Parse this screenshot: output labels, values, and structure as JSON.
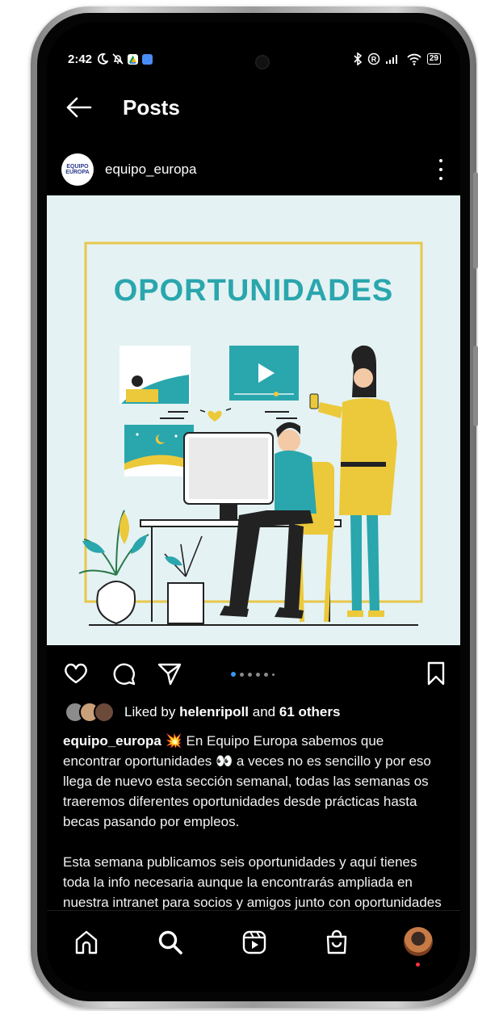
{
  "status_bar": {
    "time": "2:42",
    "battery": "29"
  },
  "app_bar": {
    "title": "Posts"
  },
  "post": {
    "username": "equipo_europa",
    "avatar_text": "EQUIPO EUROPA",
    "image": {
      "heading": "OPORTUNIDADES",
      "background_color": "#e4f2f3",
      "frame_color": "#e8c74a",
      "accent_teal": "#2aa6ad",
      "accent_yellow": "#ecc93a"
    },
    "carousel": {
      "total": 6,
      "active": 1
    },
    "likes": {
      "prefix": "Liked by",
      "user": "helenripoll",
      "middle": "and",
      "others": "61 others"
    },
    "caption": {
      "username": "equipo_europa",
      "paragraph1": "💥 En Equipo Europa sabemos que encontrar oportunidades 👀 a veces no es sencillo y por eso llega de nuevo esta sección semanal, todas las semanas os traeremos diferentes oportunidades desde prácticas hasta becas pasando por empleos.",
      "paragraph2": "Esta semana publicamos seis oportunidades y aquí tienes toda la info necesaria aunque la encontrarás ampliada en nuestra intranet para socios y amigos junto con oportunidades de Empleo, Voluntariado, Formación,"
    }
  },
  "bottom_nav": {
    "items": [
      "home-icon",
      "search-icon",
      "reels-icon",
      "shop-icon",
      "profile-avatar"
    ],
    "active": "search-icon"
  }
}
